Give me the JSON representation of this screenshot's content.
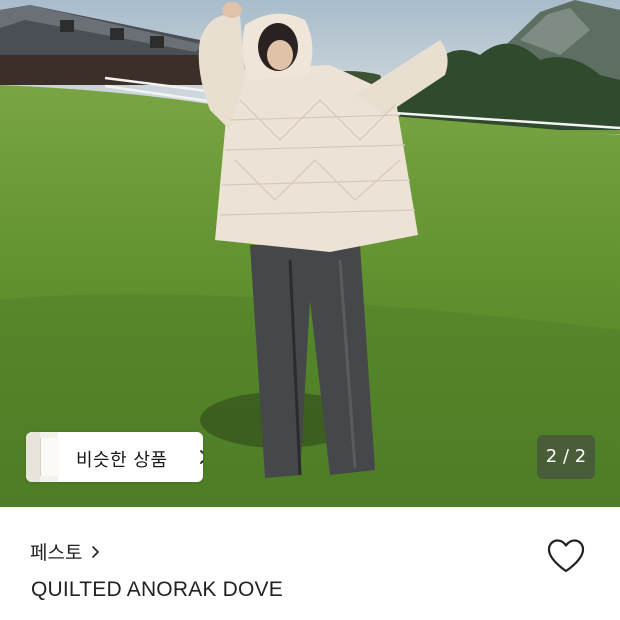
{
  "image": {
    "description_icon": "product-photo"
  },
  "similar_products": {
    "label": "비슷한 상품",
    "icon": "chevron-right-icon"
  },
  "counter": {
    "text": "2 / 2",
    "current": 2,
    "total": 2
  },
  "brand": {
    "name": "페스토",
    "icon": "chevron-right-icon"
  },
  "product": {
    "name": "QUILTED ANORAK DOVE"
  },
  "wishlist": {
    "icon": "heart-outline-icon"
  },
  "colors": {
    "text": "#222222",
    "counter_bg": "#464646"
  }
}
